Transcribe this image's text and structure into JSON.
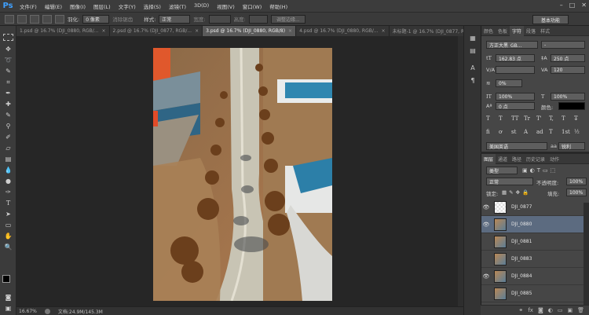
{
  "app": {
    "logo": "Ps"
  },
  "menu": [
    "文件(F)",
    "编辑(E)",
    "图像(I)",
    "图层(L)",
    "文字(Y)",
    "选择(S)",
    "滤镜(T)",
    "3D(D)",
    "视图(V)",
    "窗口(W)",
    "帮助(H)"
  ],
  "options": {
    "feather_label": "羽化:",
    "feather_value": "0 像素",
    "antialias_label": "消除锯齿",
    "style_label": "样式:",
    "style_value": "正常",
    "width_label": "宽度:",
    "height_label": "高度:",
    "refine_edge_button": "调整边缘...",
    "workspace_button": "基本功能"
  },
  "doc_tabs": [
    {
      "label": "1.psd @ 16.7% (DJI_0880, RGB/...",
      "active": false
    },
    {
      "label": "2.psd @ 16.7% (DJI_0877, RGB/...",
      "active": false
    },
    {
      "label": "3.psd @ 16.7% (DJI_0880, RGB/8)",
      "active": true
    },
    {
      "label": "4.psd @ 16.7% (DJI_0880, RGB/...",
      "active": false
    },
    {
      "label": "未标题-1 @ 16.7% (DJI_0877, RGB/...",
      "active": false
    }
  ],
  "status": {
    "zoom": "16.67%",
    "doc_size": "文档:24.9M/145.3M"
  },
  "char_panel": {
    "tabs": [
      "颜色",
      "色板",
      "字符",
      "段落",
      "样式"
    ],
    "active_tab": "字符",
    "font_family": "方正大黑_GB...",
    "font_style": "-",
    "font_size": "162.83 点",
    "leading": "250 点",
    "kerning": "",
    "tracking": "120",
    "scale_pct": "0%",
    "vertical_scale": "100%",
    "horizontal_scale": "100%",
    "baseline_shift": "0 点",
    "color_label": "颜色:",
    "language": "美国英语",
    "aa_label": "aa",
    "aa_value": "锐利",
    "type_buttons": [
      "T",
      "T",
      "TT",
      "Tr",
      "T'",
      "T,",
      "T",
      "T̶"
    ],
    "ot_buttons": [
      "fi",
      "ơ",
      "st",
      "A",
      "ad",
      "T",
      "1st",
      "½"
    ]
  },
  "layers_panel": {
    "tabs": [
      "图层",
      "通道",
      "路径",
      "历史记录",
      "动作"
    ],
    "active_tab": "图层",
    "filter_kind": "类型",
    "blend_mode": "正常",
    "opacity_label": "不透明度:",
    "opacity_value": "100%",
    "lock_label": "锁定:",
    "fill_label": "填充:",
    "fill_value": "100%",
    "layers": [
      {
        "name": "DJI_0877",
        "visible": true,
        "selected": false,
        "blank": true
      },
      {
        "name": "DJI_0880",
        "visible": true,
        "selected": true,
        "blank": false
      },
      {
        "name": "DJI_0881",
        "visible": false,
        "selected": false,
        "blank": false
      },
      {
        "name": "DJI_0883",
        "visible": false,
        "selected": false,
        "blank": false
      },
      {
        "name": "DJI_0884",
        "visible": true,
        "selected": false,
        "blank": false
      },
      {
        "name": "DJI_0885",
        "visible": false,
        "selected": false,
        "blank": false
      }
    ]
  }
}
